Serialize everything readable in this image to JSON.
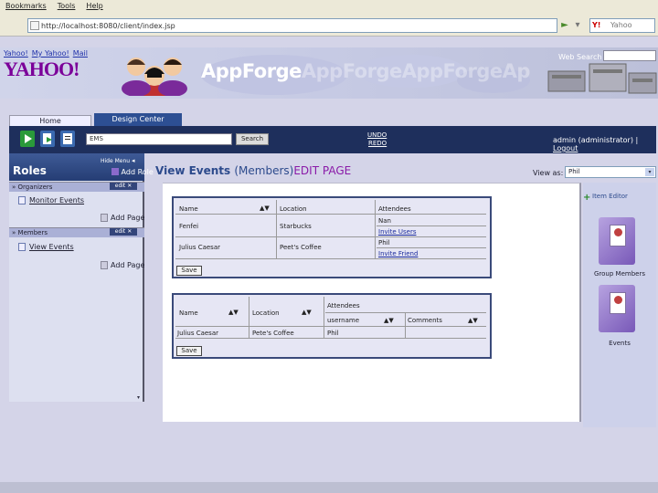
{
  "browser": {
    "menus": [
      "Bookmarks",
      "Tools",
      "Help"
    ],
    "url": "http://localhost:8080/client/index.jsp",
    "search_placeholder": "Yahoo",
    "search_brand": "Y!"
  },
  "banner": {
    "links": [
      "Yahoo!",
      "My Yahoo!",
      "Mail"
    ],
    "logo": "YAHOO!",
    "app_name": "AppForge",
    "app_name_ghost": "AppForgeAppForgeAp",
    "web_search_label": "Web Search"
  },
  "tabs": [
    {
      "label": "Home",
      "active": false
    },
    {
      "label": "Design Center",
      "active": true
    }
  ],
  "toolbar": {
    "search_value": "EMS",
    "search_button": "Search",
    "undo": "UNDO",
    "redo": "REDO",
    "user_text": "admin (administrator) |",
    "logout": "Logout"
  },
  "sidebar": {
    "title": "Roles",
    "hide_menu": "Hide Menu",
    "add_role": "Add Role",
    "groups": [
      {
        "name": "Organizers",
        "tools": "edit",
        "items": [
          "Monitor Events"
        ],
        "add_page": "Add Page"
      },
      {
        "name": "Members",
        "tools": "edit",
        "items": [
          "View Events"
        ],
        "add_page": "Add Page"
      }
    ]
  },
  "main": {
    "title": "View Events",
    "role": "(Members)",
    "edit": "EDIT PAGE",
    "view_as_label": "View as:",
    "view_as_value": "Phil"
  },
  "table1": {
    "headers": [
      "Name",
      "Location",
      "Attendees"
    ],
    "rows": [
      {
        "name": "Fenfei",
        "location": "Starbucks",
        "attendees": [
          "Nan",
          "Invite Users"
        ]
      },
      {
        "name": "Julius Caesar",
        "location": "Peet's Coffee",
        "attendees": [
          "Phil",
          "Invite Friend"
        ]
      }
    ],
    "save": "Save"
  },
  "table2": {
    "headers": [
      "Name",
      "Location",
      "Attendees"
    ],
    "sub_headers": [
      "username",
      "Comments"
    ],
    "rows": [
      {
        "name": "Julius Caesar",
        "location": "Pete's Coffee",
        "username": "Phil",
        "comments": ""
      }
    ],
    "save": "Save"
  },
  "right_panel": {
    "item_editor": "Item Editor",
    "folders": [
      "Group Members",
      "Events"
    ]
  },
  "colors": {
    "brand_purple": "#7b0099",
    "dark_bar": "#1e2f5c",
    "title_blue": "#2c4a8c",
    "edit_purple": "#8a1aa8"
  }
}
